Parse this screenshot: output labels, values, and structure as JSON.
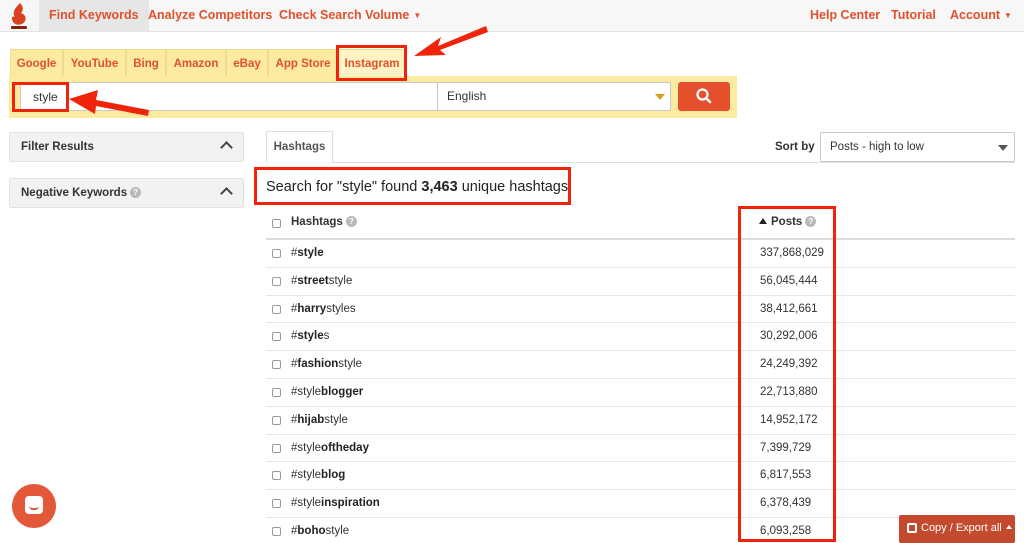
{
  "nav": {
    "left": [
      {
        "label": "Find Keywords"
      },
      {
        "label": "Analyze Competitors"
      },
      {
        "label": "Check Search Volume"
      }
    ],
    "right": [
      {
        "label": "Help Center"
      },
      {
        "label": "Tutorial"
      },
      {
        "label": "Account"
      }
    ]
  },
  "sources": [
    "Google",
    "YouTube",
    "Bing",
    "Amazon",
    "eBay",
    "App Store",
    "Instagram"
  ],
  "active_source": "Instagram",
  "search": {
    "keyword": "style",
    "language": "English"
  },
  "filters": {
    "filter_results": "Filter Results",
    "negative_keywords": "Negative Keywords"
  },
  "results": {
    "tab": "Hashtags",
    "sort_label": "Sort by",
    "sort_value": "Posts - high to low",
    "summary_prefix": "Search for \"style\" found",
    "summary_count": "3,463",
    "summary_suffix": "unique hashtags",
    "col_hashtags": "Hashtags",
    "col_posts": "Posts",
    "rows": [
      {
        "pre": "#",
        "bold": "style",
        "post": "",
        "posts": "337,868,029"
      },
      {
        "pre": "#",
        "bold": "street",
        "post": "style",
        "posts": "56,045,444"
      },
      {
        "pre": "#",
        "bold": "harry",
        "post": "styles",
        "posts": "38,412,661"
      },
      {
        "pre": "#",
        "bold": "style",
        "post": "s",
        "posts": "30,292,006"
      },
      {
        "pre": "#",
        "bold": "fashion",
        "post": "style",
        "posts": "24,249,392"
      },
      {
        "pre": "#style",
        "bold": "blogger",
        "post": "",
        "posts": "22,713,880"
      },
      {
        "pre": "#",
        "bold": "hijab",
        "post": "style",
        "posts": "14,952,172"
      },
      {
        "pre": "#style",
        "bold": "oftheday",
        "post": "",
        "posts": "7,399,729"
      },
      {
        "pre": "#style",
        "bold": "blog",
        "post": "",
        "posts": "6,817,553"
      },
      {
        "pre": "#style",
        "bold": "inspiration",
        "post": "",
        "posts": "6,378,439"
      },
      {
        "pre": "#",
        "bold": "boho",
        "post": "style",
        "posts": "6,093,258"
      }
    ]
  },
  "export_label": "Copy / Export all",
  "colors": {
    "brand_orange": "#e0512c",
    "highlight_red": "#f0230b",
    "search_strip": "#fbeaa0"
  },
  "icons": [
    "logo-flame-icon",
    "search-icon",
    "chevron-up-icon",
    "help-icon",
    "sort-up-icon",
    "chat-icon",
    "export-icon"
  ]
}
